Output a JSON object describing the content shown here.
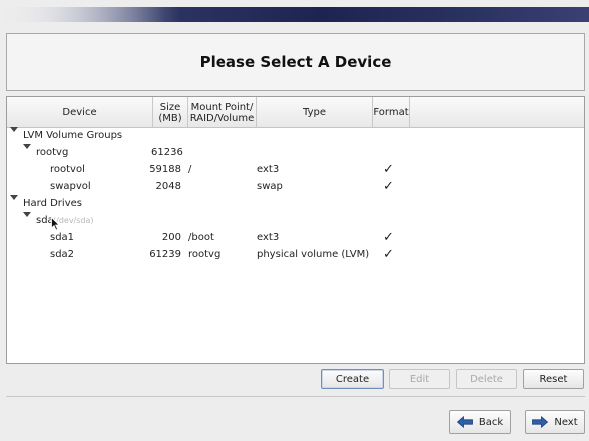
{
  "page": {
    "title": "Please Select A Device"
  },
  "table": {
    "columns": {
      "device": "Device",
      "size": "Size\n(MB)",
      "mount": "Mount Point/\nRAID/Volume",
      "type": "Type",
      "format": "Format"
    },
    "rows": [
      {
        "device": "LVM Volume Groups",
        "size": "",
        "mount": "",
        "type": "",
        "format": false,
        "level": 0,
        "expandable": true
      },
      {
        "device": "rootvg",
        "size": "61236",
        "mount": "",
        "type": "",
        "format": false,
        "level": 1,
        "expandable": true
      },
      {
        "device": "rootvol",
        "size": "59188",
        "mount": "/",
        "type": "ext3",
        "format": true,
        "level": 2,
        "expandable": false
      },
      {
        "device": "swapvol",
        "size": "2048",
        "mount": "",
        "type": "swap",
        "format": true,
        "level": 2,
        "expandable": false
      },
      {
        "device": "Hard Drives",
        "size": "",
        "mount": "",
        "type": "",
        "format": false,
        "level": 0,
        "expandable": true
      },
      {
        "device": "sda",
        "device_detail": "(/dev/sda)",
        "size": "",
        "mount": "",
        "type": "",
        "format": false,
        "level": 1,
        "expandable": true
      },
      {
        "device": "sda1",
        "size": "200",
        "mount": "/boot",
        "type": "ext3",
        "format": true,
        "level": 2,
        "expandable": false
      },
      {
        "device": "sda2",
        "size": "61239",
        "mount": "rootvg",
        "type": "physical volume (LVM)",
        "format": true,
        "level": 2,
        "expandable": false
      }
    ],
    "check_glyph": "✓"
  },
  "actions": {
    "create": "Create",
    "edit": "Edit",
    "delete": "Delete",
    "reset": "Reset"
  },
  "navigation": {
    "back": "Back",
    "next": "Next"
  },
  "colors": {
    "banner": "#1e2452",
    "arrow_blue": "#2f5fa8"
  }
}
